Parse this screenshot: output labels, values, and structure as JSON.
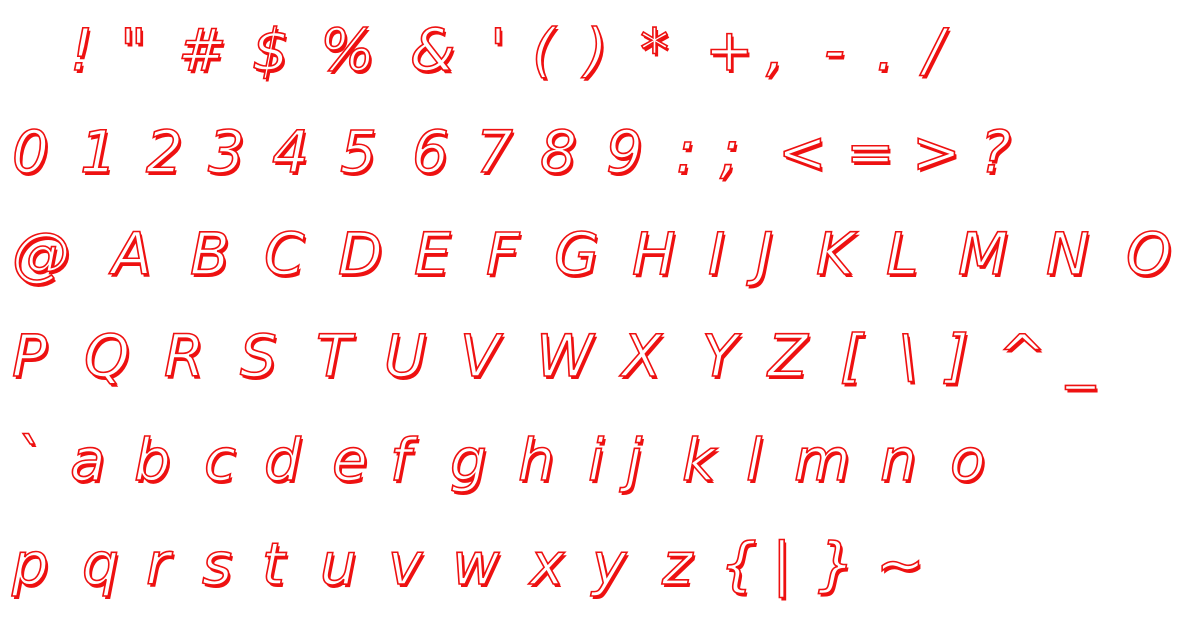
{
  "specimen": {
    "rows": [
      [
        "!",
        "\"",
        "#",
        "$",
        "%",
        "&",
        "'",
        "(",
        ")",
        "*",
        "+",
        ",",
        "-",
        ".",
        "/"
      ],
      [
        "0",
        "1",
        "2",
        "3",
        "4",
        "5",
        "6",
        "7",
        "8",
        "9",
        ":",
        ";",
        "<",
        "=",
        ">",
        "?"
      ],
      [
        "@",
        "A",
        "B",
        "C",
        "D",
        "E",
        "F",
        "G",
        "H",
        "I",
        "J",
        "K",
        "L",
        "M",
        "N",
        "O"
      ],
      [
        "P",
        "Q",
        "R",
        "S",
        "T",
        "U",
        "V",
        "W",
        "X",
        "Y",
        "Z",
        "[",
        "\\",
        "]",
        "^",
        "_"
      ],
      [
        "`",
        "a",
        "b",
        "c",
        "d",
        "e",
        "f",
        "g",
        "h",
        "i",
        "j",
        "k",
        "l",
        "m",
        "n",
        "o"
      ],
      [
        "p",
        "q",
        "r",
        "s",
        "t",
        "u",
        "v",
        "w",
        "x",
        "y",
        "z",
        "{",
        "|",
        "}",
        "~"
      ]
    ]
  },
  "colors": {
    "outline": "#ee1111",
    "fill": "#ffffff",
    "background": "#ffffff"
  }
}
